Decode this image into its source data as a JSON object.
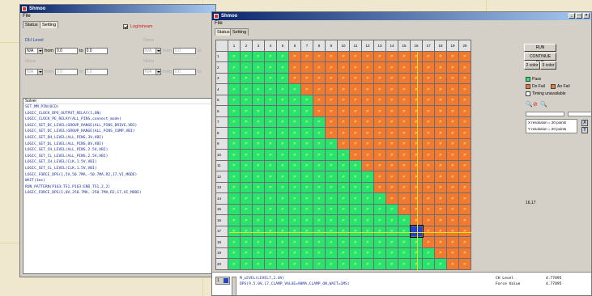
{
  "colors": {
    "pass": "#28e36e",
    "fail": "#f07a32",
    "title_start": "#0a246a",
    "title_end": "#a6caf0",
    "log_text": "#1a2d9a",
    "checkbox_label": "#cc1a1a",
    "active_heading": "#1a3fb0"
  },
  "window1": {
    "title": "Shmoo",
    "menu": "File",
    "tabs": [
      "Status",
      "Setting"
    ],
    "log_label": "Log/stream",
    "levels": [
      {
        "title": "DH Level",
        "combo": "N/A",
        "from_label": "from",
        "from": "0.0",
        "to_label": "to",
        "to": "0.0"
      },
      {
        "title": "None",
        "combo": "N/A",
        "from_label": "from",
        "from": "0.0",
        "to_label": "to",
        "to": "0.0"
      },
      {
        "title": "None",
        "combo": "N/A",
        "from_label": "from",
        "from": "0.0",
        "to_label": "to",
        "to": "0.0"
      },
      {
        "title": "None",
        "combo": "N/A",
        "from_label": "from",
        "from": "0.0",
        "to_label": "to",
        "to": "0.0"
      }
    ],
    "log_header": "Solver",
    "log_lines": [
      "SET_MM_PIN(0CO)",
      "LOGIC_CLOCK_DPS_OUTPUT_RELAY(1,ON)",
      "LOGIC_CLOCK_PE_RELAY(ALL_PINS,connect_mode)",
      "LOGIC_SET_DC_LEVEL(GROUP_RANGE(ALL_PINS_DRIVE,VBI)",
      "LOGIC_SET_DC_LEVEL(GROUP_RANGE(ALL_PINS_COMP,VBI)",
      "LOGIC_SET_DH_LEVEL(ALL_PINS,3V,VBI)",
      "LOGIC_SET_DL_LEVEL(ALL_PINS,0V,VBI)",
      "LOGIC_SET_CH_LEVEL(ALL_PINS,2.5V,VBI)",
      "LOGIC_SET_CL_LEVEL(ALL_PINS,2.5V,VBI)",
      "LOGIC_SET_CH_LEVEL(CLK,1.5V,VBI)",
      "LOGIC_SET_CL_LEVEL(CLK,1.5V,VBI)",
      "LOGIC_FORCE_DPS(1,5V,50.7MA,-50.7MA,R2,17,VI_MODE)",
      "WAIT(1ms)",
      "RUN_PATTERN(P163:TS1,P163:END_TS1,2,2)",
      "LOGIC_FORCE_DPS(1,0V,250.7MA,-250.7MA,R2,17,VI_MODE)"
    ]
  },
  "window2": {
    "title": "Shmoo",
    "menu": "File",
    "tabs": [
      "Status",
      "Setting"
    ],
    "columns": [
      "1",
      "2",
      "3",
      "4",
      "5",
      "6",
      "7",
      "8",
      "9",
      "10",
      "11",
      "12",
      "13",
      "14",
      "15",
      "16",
      "17",
      "18",
      "19",
      "20"
    ],
    "rows": [
      "1",
      "2",
      "3",
      "4",
      "5",
      "6",
      "7",
      "8",
      "9",
      "10",
      "11",
      "12",
      "13",
      "14",
      "15",
      "16",
      "17",
      "18",
      "19",
      "20"
    ],
    "cell_mark": "P",
    "pass_counts": [
      5,
      5,
      5,
      6,
      7,
      7,
      8,
      8,
      9,
      10,
      11,
      12,
      12,
      13,
      14,
      15,
      16,
      16,
      17,
      18
    ],
    "cursor": {
      "row": 17,
      "col": 16
    },
    "marker_row": 17,
    "marker_col": 16,
    "run_button": "RUN",
    "continue_button": "CONTINUE RUN",
    "color_buttons": [
      "2 color",
      "3 color"
    ],
    "legend": [
      {
        "label": "Pass",
        "color": "#28e36e"
      },
      {
        "label": "Do Fail",
        "color": "#f07a32"
      },
      {
        "label": "Ao Fail",
        "color": "#f07a32"
      },
      {
        "label": "Timing unavailable",
        "color": "#ffffff"
      }
    ],
    "x_resolution": "X resolution = 20 points",
    "y_resolution": "Y resolution = 20 points",
    "x_button": "X",
    "y_button": "Y",
    "coord_readout": "16,17",
    "status": {
      "mode": "1",
      "line1": "M_LEVEL(LEVEL7,2.0V)",
      "line2": "DPS(9,5.0V,17,CLAMP_VALUE=90MA,CLAMP_ON,WAIT=1MS)",
      "kv": [
        {
          "label": "CH Level",
          "value": "4.77895"
        },
        {
          "label": "Force Value",
          "value": "4.77895"
        }
      ]
    }
  }
}
